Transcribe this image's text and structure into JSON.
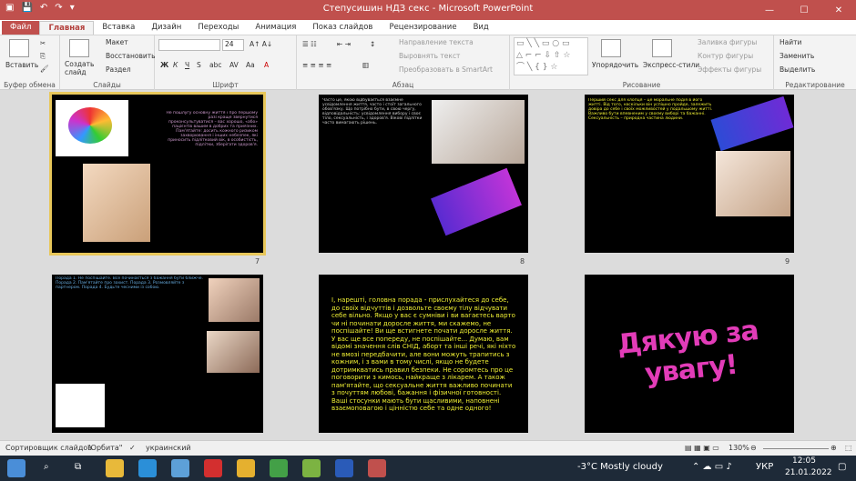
{
  "window": {
    "title": "Степусишин НДЗ секс - Microsoft PowerPoint"
  },
  "tabs": [
    "Файл",
    "Главная",
    "Вставка",
    "Дизайн",
    "Переходы",
    "Анимация",
    "Показ слайдов",
    "Рецензирование",
    "Вид"
  ],
  "ribbon": {
    "paste": "Вставить",
    "new_slide": "Создать слайд",
    "layout": "Макет",
    "reset": "Восстановить",
    "section": "Раздел",
    "font_size": "24",
    "text_direction": "Направление текста",
    "align_text": "Выровнять текст",
    "smartart": "Преобразовать в SmartArt",
    "arrange": "Упорядочить",
    "quick_styles": "Экспресс-стили",
    "shape_fill": "Заливка фигуры",
    "shape_outline": "Контур фигуры",
    "shape_effects": "Эффекты фигуры",
    "find": "Найти",
    "replace": "Заменить",
    "select": "Выделить",
    "groups": {
      "clipboard": "Буфер обмена",
      "slides": "Слайды",
      "font": "Шрифт",
      "paragraph": "Абзац",
      "drawing": "Рисование",
      "editing": "Редактирование"
    }
  },
  "slides": [
    {
      "num": "7",
      "text": "Не пошлугу основну життя і про першому разі краще звернутися проконсультуватися – вас хорошо, «або» пацієнтів вашим в добрих та приязних. Пам'ятайте: досить кожного ризиком захворювання і інших небезпек, які приносить підлітковий вік, в особистість, підлітки, зберігати здоров'я."
    },
    {
      "num": "8",
      "text": "Часто це, якою відбувається взаємне усвідомлення життя, часто і стоїт загального обов'язку. Що потрібно бути, в свою чергу, відповідальність: усвідомлення вибору і своє тіло, сексуальність, і здоров'я. Вікові підлітки часто вимагають рішень."
    },
    {
      "num": "9",
      "text": "Перший секс для хлопця – це моральне подія в його житті. Від того, наскільки він успішно пройде, залежить довіра до себе і своїх можливостей у подальшому житті. Важливо бути впевненим у своєму виборі та бажанні. Сексуальність – природна частина людини."
    },
    {
      "num": "",
      "text": "Порада 1. Не поспішайте. Все починається з бажання бути ближче. Порада 2. Пам'ятайте про захист. Порада 3. Розмовляйте з партнером. Порада 4. Будьте чесними із собою."
    },
    {
      "num": "",
      "text": "І, нарешті, головна порада - прислухайтеся до себе, до своїх відчуттів і дозвольте своєму тілу відчувати себе вільно. Якщо у вас є сумніви і ви вагаєтесь варто чи ні починати доросле життя, ми скажемо, не поспішайте! Ви ще встигнете почати доросле життя. У вас ще все попереду, не поспішайте... Думаю, вам відомі значення слів СНІД, аборт та інші речі, які ніхто не вмозі передбачити, але вони можуть трапитись з кожним, і з вами в тому числі, якщо не будете дотримкватись правил безпеки. Не соромтесь про це поговорити з кимось, найкраще з лікарем. А також пам'ятайте, що сексуальне життя важливо починати з почуттям любові, бажання і фізичної готовності. Ваші стосунки мають бути щасливими, наповнені взаємоповагою і цінністю себе та одне одного!"
    },
    {
      "num": "",
      "text": "Дякую за увагу!"
    }
  ],
  "status": {
    "view": "Сортировщик слайдов",
    "theme": "\"Орбита\"",
    "language": "украинский",
    "zoom": "130%"
  },
  "taskbar": {
    "weather": "-3°C Mostly cloudy",
    "lang": "УКР",
    "time": "12:05",
    "date": "21.01.2022"
  },
  "colors": {
    "accent": "#c0504d",
    "taskbar": "#1e2a38"
  }
}
